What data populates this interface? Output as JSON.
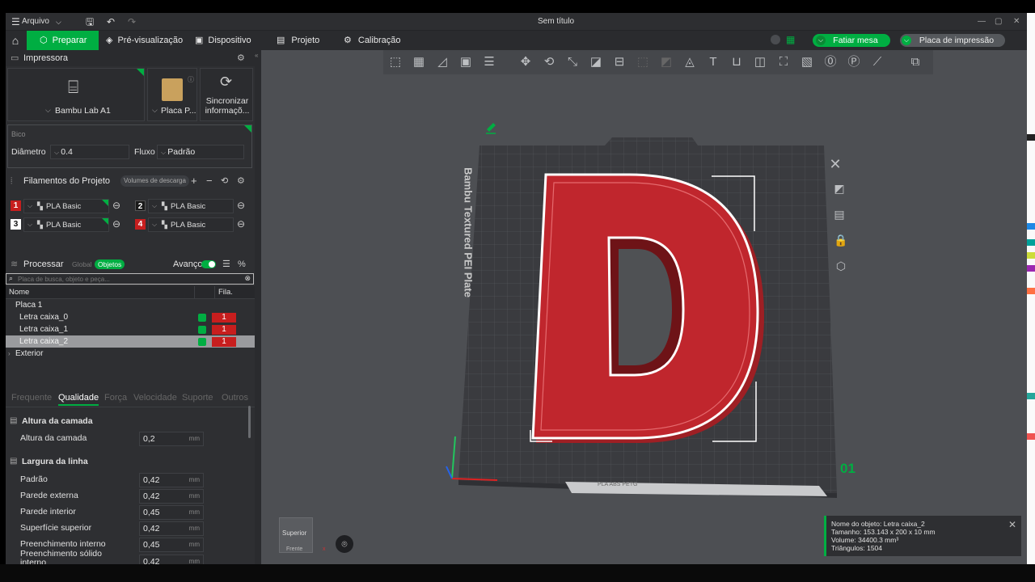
{
  "titlebar": {
    "menu_label": "Arquivo",
    "title": "Sem título"
  },
  "nav": {
    "prepare": "Preparar",
    "preview": "Pré-visualização",
    "device": "Dispositivo",
    "project": "Projeto",
    "calibration": "Calibração",
    "slice_plate": "Fatiar mesa",
    "print_plate": "Placa de impressão"
  },
  "printer": {
    "section_title": "Impressora",
    "printer_name": "Bambu Lab A1",
    "plate_name": "Placa P...",
    "sync_line1": "Sincronizar",
    "sync_line2": "informaçõ..."
  },
  "nozzle": {
    "title": "Bico",
    "diameter_label": "Diâmetro",
    "diameter_value": "0.4",
    "flow_label": "Fluxo",
    "flow_value": "Padrão"
  },
  "filaments": {
    "section_title": "Filamentos do Projeto",
    "flush_volumes": "Volumes de descarga",
    "items": [
      {
        "num": "1",
        "name": "PLA Basic",
        "color": "#c71e1e"
      },
      {
        "num": "2",
        "name": "PLA Basic",
        "color": "#1a1a1a"
      },
      {
        "num": "3",
        "name": "PLA Basic",
        "color": "#ffffff"
      },
      {
        "num": "4",
        "name": "PLA Basic",
        "color": "#c71e1e"
      }
    ]
  },
  "process": {
    "section_title": "Processar",
    "global": "Global",
    "objects": "Objetos",
    "advanced": "Avanço",
    "search_placeholder": "Placa de busca, objeto e peça..."
  },
  "objects": {
    "col_name": "Nome",
    "col_fil": "Fila.",
    "plate": "Placa 1",
    "items": [
      {
        "name": "Letra caixa_0",
        "fil": "1"
      },
      {
        "name": "Letra caixa_1",
        "fil": "1"
      },
      {
        "name": "Letra caixa_2",
        "fil": "1"
      }
    ],
    "exterior": "Exterior"
  },
  "quality_tabs": [
    "Frequente",
    "Qualidade",
    "Força",
    "Velocidade",
    "Suporte",
    "Outros"
  ],
  "layer_height": {
    "group": "Altura da camada",
    "label": "Altura da camada",
    "value": "0,2",
    "unit": "mm"
  },
  "line_width": {
    "group": "Largura da linha",
    "unit": "mm",
    "rows": [
      {
        "label": "Padrão",
        "value": "0,42"
      },
      {
        "label": "Parede externa",
        "value": "0,42"
      },
      {
        "label": "Parede interior",
        "value": "0,45"
      },
      {
        "label": "Superfície superior",
        "value": "0,42"
      },
      {
        "label": "Preenchimento interno",
        "value": "0,45"
      },
      {
        "label": "Preenchimento sólido",
        "label2": "interno",
        "value": "0,42"
      }
    ]
  },
  "viewport": {
    "plate_text": "Bambu Textured PEI Plate",
    "plate_number": "01",
    "plate_label": "PLA ABS PETG",
    "letter": "D",
    "view_top": "Superior",
    "view_front": "Frente",
    "axis_x": "x"
  },
  "object_info": {
    "name": "Nome do objeto: Letra caixa_2",
    "size": "Tamanho: 153.143 x 200 x 10 mm",
    "volume": "Volume: 34400.3 mm³",
    "triangles": "Triângulos: 1504"
  },
  "colors": {
    "accent": "#00ae42",
    "filament_red": "#c71e1e",
    "letter_red": "#c0262d"
  }
}
